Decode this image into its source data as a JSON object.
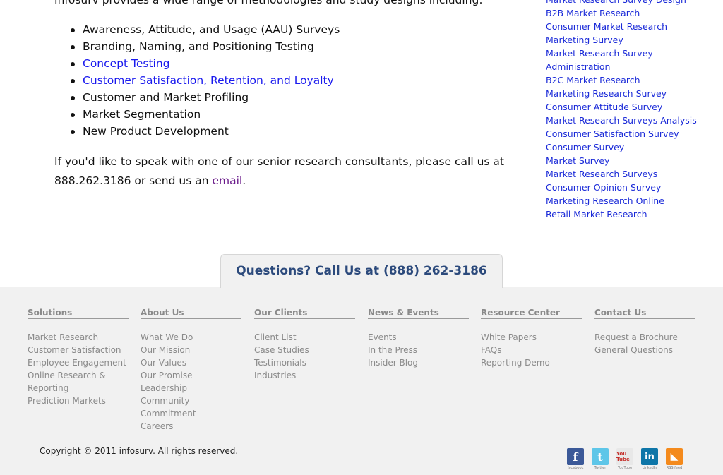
{
  "main": {
    "intro": "Infosurv provides a wide range of methodologies and study designs including:",
    "bullets": [
      {
        "text": "Awareness, Attitude, and Usage (AAU) Surveys",
        "link": false
      },
      {
        "text": "Branding, Naming, and Positioning Testing",
        "link": false
      },
      {
        "text": "Concept Testing",
        "link": true
      },
      {
        "text": "Customer Satisfaction, Retention, and Loyalty",
        "link": true
      },
      {
        "text": "Customer and Market Profiling",
        "link": false
      },
      {
        "text": "Market Segmentation",
        "link": false
      },
      {
        "text": "New Product Development",
        "link": false
      }
    ],
    "contact_before": "If you'd like to speak with one of our senior research consultants, please call us at 888.262.3186 or send us an ",
    "contact_link": "email",
    "contact_after": "."
  },
  "side_links": [
    "Market Research Survey Design",
    "B2B Market Research",
    "Consumer Market Research",
    "Marketing Survey",
    "Market Research Survey",
    "Administration",
    "B2C Market Research",
    "Marketing Research Survey",
    "Consumer Attitude Survey",
    "Market Research Surveys Analysis",
    "Consumer Satisfaction Survey",
    "Consumer Survey",
    "Market Survey",
    "Market Research Surveys",
    "Consumer Opinion Survey",
    "Marketing Research Online",
    "Retail Market Research"
  ],
  "footer": {
    "question": "Questions? Call Us at (888) 262-3186",
    "columns": [
      {
        "title": "Solutions",
        "items": [
          "Market Research",
          "Customer Satisfaction",
          "Employee Engagement",
          "Online Research & Reporting",
          "Prediction Markets"
        ]
      },
      {
        "title": "About Us",
        "items": [
          "What We Do",
          "Our Mission",
          "Our Values",
          "Our Promise",
          "Leadership",
          "Community Commitment",
          "Careers"
        ]
      },
      {
        "title": "Our Clients",
        "items": [
          "Client List",
          "Case Studies",
          "Testimonials",
          "Industries"
        ]
      },
      {
        "title": "News & Events",
        "items": [
          "Events",
          "In the Press",
          "Insider Blog"
        ]
      },
      {
        "title": "Resource Center",
        "items": [
          "White Papers",
          "FAQs",
          "Reporting Demo"
        ]
      },
      {
        "title": "Contact Us",
        "items": [
          "Request a Brochure",
          "General Questions"
        ]
      }
    ],
    "copyright": "Copyright © 2011 infosurv. All rights reserved.",
    "social": [
      {
        "icon": "facebook-icon",
        "glyph": "f",
        "caption": "facebook",
        "color": "#3b5998"
      },
      {
        "icon": "twitter-icon",
        "glyph": "t",
        "caption": "Twitter",
        "color": "#5ec6e8"
      },
      {
        "icon": "youtube-icon",
        "glyph": "You Tube",
        "caption": "YouTube",
        "color": "#e8e8e8"
      },
      {
        "icon": "linkedin-icon",
        "glyph": "in",
        "caption": "LinkedIn",
        "color": "#0e76a8"
      },
      {
        "icon": "rss-icon",
        "glyph": "◣",
        "caption": "RSS feed",
        "color": "#f48a1c"
      }
    ]
  }
}
